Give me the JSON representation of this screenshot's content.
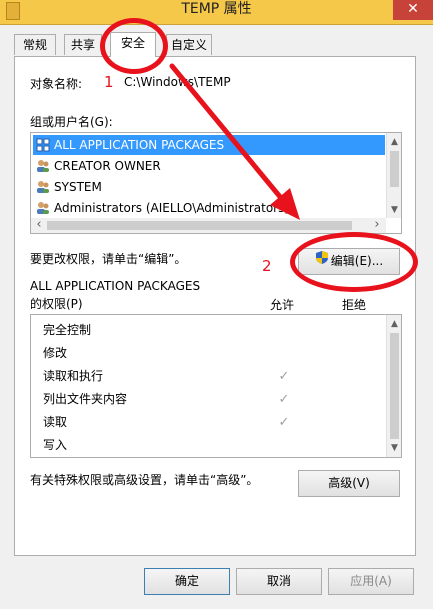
{
  "window": {
    "title": "TEMP 属性",
    "close_glyph": "✕"
  },
  "tabs": [
    {
      "label": "常规"
    },
    {
      "label": "共享"
    },
    {
      "label": "安全"
    },
    {
      "label": "自定义"
    }
  ],
  "security": {
    "object_name_label": "对象名称:",
    "object_name_value": "C:\\Windows\\TEMP",
    "groups_label": "组或用户名(G):",
    "groups": [
      {
        "name": "ALL APPLICATION PACKAGES",
        "icon": "package-group-icon",
        "selected": true
      },
      {
        "name": "CREATOR OWNER",
        "icon": "users-group-icon",
        "selected": false
      },
      {
        "name": "SYSTEM",
        "icon": "users-group-icon",
        "selected": false
      },
      {
        "name": "Administrators (AIELLO\\Administrators)",
        "icon": "users-group-icon",
        "selected": false
      }
    ],
    "edit_hint": "要更改权限，请单击“编辑”。",
    "edit_button": "编辑(E)...",
    "permissions_for_line1": "ALL APPLICATION PACKAGES",
    "permissions_for_line2": "的权限(P)",
    "allow_header": "允许",
    "deny_header": "拒绝",
    "permissions": [
      {
        "name": "完全控制",
        "allow": false
      },
      {
        "name": "修改",
        "allow": false
      },
      {
        "name": "读取和执行",
        "allow": true
      },
      {
        "name": "列出文件夹内容",
        "allow": true
      },
      {
        "name": "读取",
        "allow": true
      },
      {
        "name": "写入",
        "allow": false
      }
    ],
    "advanced_hint": "有关特殊权限或高级设置，请单击“高级”。",
    "advanced_button": "高级(V)"
  },
  "footer": {
    "ok_button": "确定",
    "cancel_button": "取消",
    "apply_button": "应用(A)"
  },
  "annotations": {
    "step1": "1",
    "step2": "2",
    "color": "#e8121c"
  },
  "check_glyph": "✓",
  "scroll_arrows": {
    "up": "▲",
    "down": "▼",
    "left": "‹",
    "right": "›"
  }
}
